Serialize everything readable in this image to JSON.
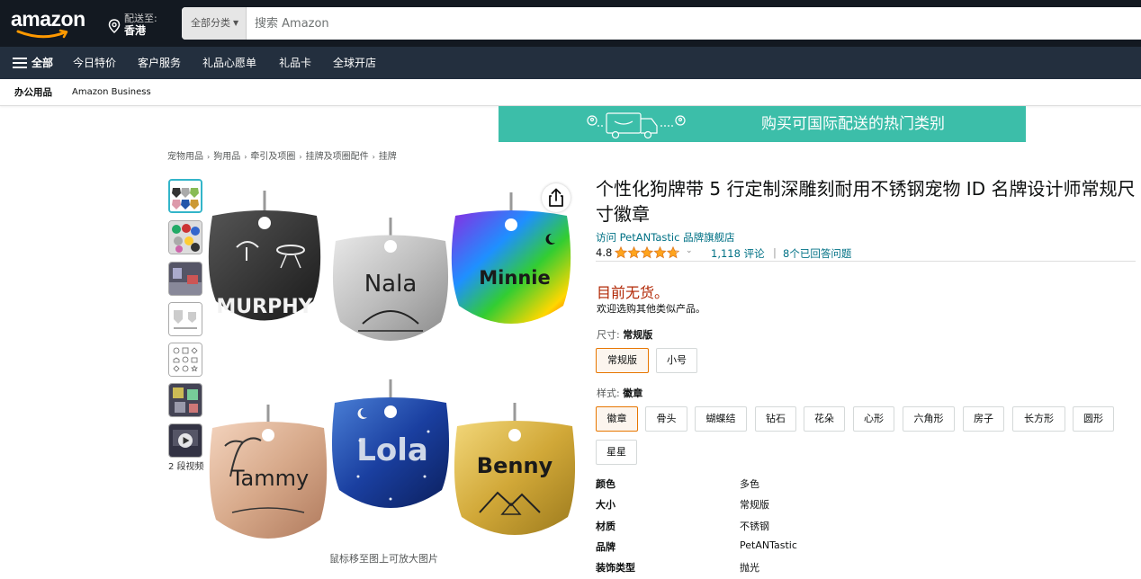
{
  "header": {
    "logo_text": "amazon",
    "deliver_line1": "配送至:",
    "deliver_line2": "香港",
    "search_category": "全部分类",
    "search_placeholder": "搜索 Amazon"
  },
  "nav": {
    "all_label": "全部",
    "items": [
      "今日特价",
      "客户服务",
      "礼品心愿单",
      "礼品卡",
      "全球开店"
    ]
  },
  "subnav": {
    "items": [
      "办公用品",
      "Amazon Business"
    ]
  },
  "banner": {
    "text": "购买可国际配送的热门类别",
    "color": "#3cbea9"
  },
  "breadcrumb": [
    "宠物用品",
    "狗用品",
    "牵引及项圈",
    "挂牌及项圈配件",
    "挂牌"
  ],
  "gallery": {
    "thumb_icons": [
      "tags-collage-thumb",
      "tags-colors-thumb",
      "tags-lifestyle-thumb",
      "size-chart-thumb",
      "shapes-chart-thumb",
      "engraving-thumb",
      "video-thumb"
    ],
    "video_label": "2 段视频",
    "hover_hint": "鼠标移至图上可放大图片",
    "tag_names": [
      "MURPHY",
      "Nala",
      "Minnie",
      "Tammy",
      "Lola",
      "Benny"
    ]
  },
  "product": {
    "title": "个性化狗牌带 5 行定制深雕刻耐用不锈钢宠物 ID 名牌设计师常规尺寸徽章",
    "store_link": "访问 PetANTastic 品牌旗舰店",
    "rating": "4.8",
    "rating_value": 4.8,
    "reviews": "1,118 评论",
    "separator": "|",
    "answered": "8个已回答问题",
    "unavailable": "目前无货。",
    "browse_similar": "欢迎选购其他类似产品。"
  },
  "size_option": {
    "label": "尺寸:",
    "selected": "常规版",
    "choices": [
      "常规版",
      "小号"
    ]
  },
  "style_option": {
    "label": "样式:",
    "selected": "徽章",
    "choices": [
      "徽章",
      "骨头",
      "蝴蝶结",
      "钻石",
      "花朵",
      "心形",
      "六角形",
      "房子",
      "长方形",
      "圆形",
      "星星"
    ]
  },
  "specs": [
    {
      "key": "颜色",
      "value": "多色"
    },
    {
      "key": "大小",
      "value": "常规版"
    },
    {
      "key": "材质",
      "value": "不锈钢"
    },
    {
      "key": "品牌",
      "value": "PetANTastic"
    },
    {
      "key": "装饰类型",
      "value": "抛光"
    }
  ],
  "colors": {
    "nav_dark": "#131921",
    "nav_secondary": "#232f3e",
    "link": "#007185",
    "unavailable": "#b12704",
    "star": "#ffa41c",
    "selected_border": "#e77600"
  }
}
